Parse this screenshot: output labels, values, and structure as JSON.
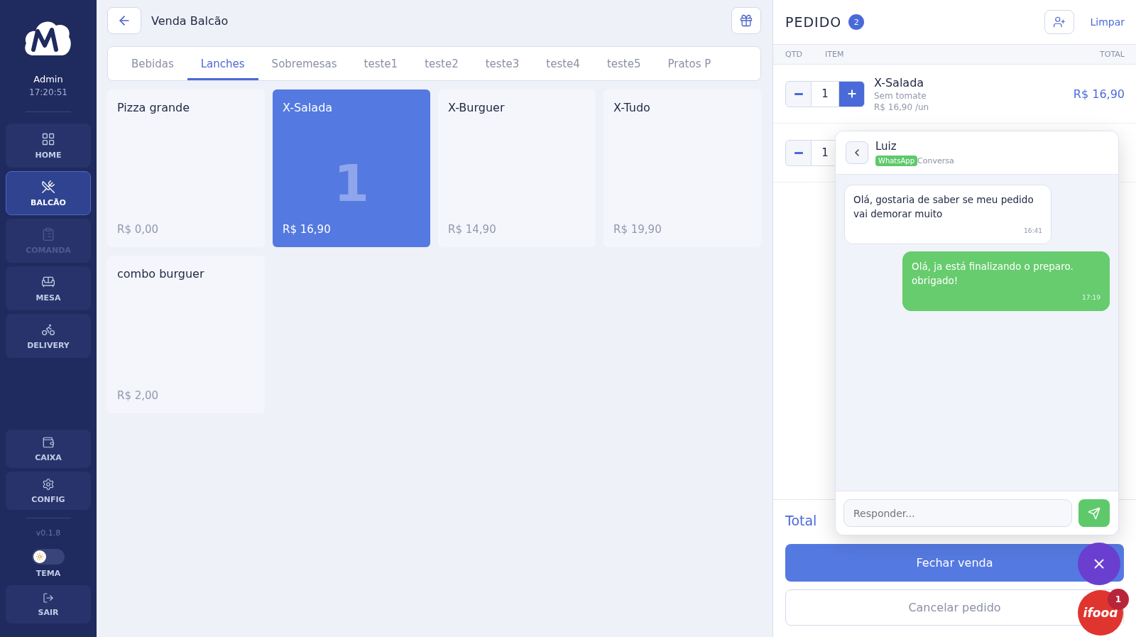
{
  "sidebar": {
    "user": "Admin",
    "time": "17:20:51",
    "items": [
      {
        "label": "HOME",
        "selected": false,
        "disabled": false
      },
      {
        "label": "BALCÃO",
        "selected": true,
        "disabled": false
      },
      {
        "label": "COMANDA",
        "selected": false,
        "disabled": true
      },
      {
        "label": "MESA",
        "selected": false,
        "disabled": false
      },
      {
        "label": "DELIVERY",
        "selected": false,
        "disabled": false
      }
    ],
    "bottom_items": [
      {
        "label": "CAIXA"
      },
      {
        "label": "CONFIG"
      }
    ],
    "version": "v0.1.8",
    "theme_toggle": {
      "label": "TEMA",
      "on": false
    },
    "logout": "SAIR"
  },
  "header": {
    "title": "Venda Balcão"
  },
  "tabs": [
    {
      "label": "Bebidas",
      "selected": false
    },
    {
      "label": "Lanches",
      "selected": true
    },
    {
      "label": "Sobremesas",
      "selected": false
    },
    {
      "label": "teste1",
      "selected": false
    },
    {
      "label": "teste2",
      "selected": false
    },
    {
      "label": "teste3",
      "selected": false
    },
    {
      "label": "teste4",
      "selected": false
    },
    {
      "label": "teste5",
      "selected": false
    },
    {
      "label": "Pratos P",
      "selected": false
    }
  ],
  "products": [
    {
      "name": "Pizza grande",
      "price": "R$ 0,00",
      "selected": false
    },
    {
      "name": "X-Salada",
      "price": "R$ 16,90",
      "selected": true,
      "count": "1"
    },
    {
      "name": "X-Burguer",
      "price": "R$ 14,90",
      "selected": false
    },
    {
      "name": "X-Tudo",
      "price": "R$ 19,90",
      "selected": false
    },
    {
      "name": "combo burguer",
      "price": "R$ 2,00",
      "selected": false
    }
  ],
  "order": {
    "title": "PEDIDO",
    "count": "2",
    "clear": "Limpar",
    "columns": [
      "QTD",
      "ITEM",
      "TOTAL"
    ],
    "items": [
      {
        "qty": "1",
        "name": "X-Salada",
        "note": "Sem tomate",
        "unit_price": "R$ 16,90 /un",
        "total": "R$ 16,90"
      },
      {
        "qty": "1"
      }
    ],
    "total_label": "Total",
    "close_sale": "Fechar venda",
    "cancel": "Cancelar pedido"
  },
  "chat": {
    "name": "Luiz",
    "channel": "WhatsApp",
    "subtitle": "Conversa",
    "messages": [
      {
        "kind": "in",
        "text": "Olá, gostaria de saber se meu pedido vai demorar muito",
        "time": "16:41"
      },
      {
        "kind": "out",
        "text": "Olá, ja está finalizando o preparo. obrigado!",
        "time": "17:19"
      }
    ],
    "placeholder": "Responder..."
  },
  "ifood": {
    "logo": "ifood",
    "badge": "1"
  }
}
